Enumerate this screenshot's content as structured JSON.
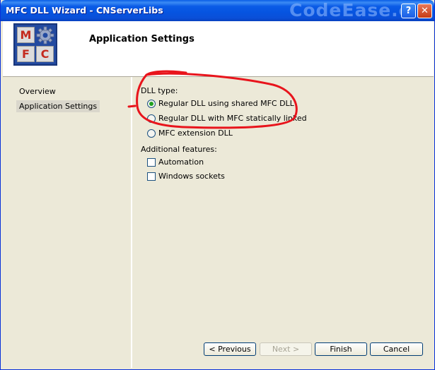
{
  "window": {
    "title": "MFC DLL Wizard - CNServerLibs",
    "watermark": "CodeEase.c",
    "help_glyph": "?",
    "close_glyph": "✕"
  },
  "header": {
    "logo_letters": [
      "M",
      "F",
      "C"
    ],
    "title": "Application Settings"
  },
  "nav": {
    "items": [
      "Overview",
      "Application Settings"
    ],
    "selected": "Application Settings"
  },
  "dll_type": {
    "label": "DLL type:",
    "options": [
      {
        "label": "Regular DLL using shared MFC DLL",
        "checked": true
      },
      {
        "label": "Regular DLL with MFC statically linked",
        "checked": false
      },
      {
        "label": "MFC extension DLL",
        "checked": false
      }
    ]
  },
  "additional_features": {
    "label": "Additional features:",
    "options": [
      {
        "label": "Automation",
        "checked": false
      },
      {
        "label": "Windows sockets",
        "checked": false
      }
    ]
  },
  "buttons": {
    "previous": "< Previous",
    "next": "Next >",
    "finish": "Finish",
    "cancel": "Cancel"
  },
  "colors": {
    "titlebar": "#0a5be6",
    "annotation": "#e8141c",
    "radio_selected": "#21a121"
  }
}
